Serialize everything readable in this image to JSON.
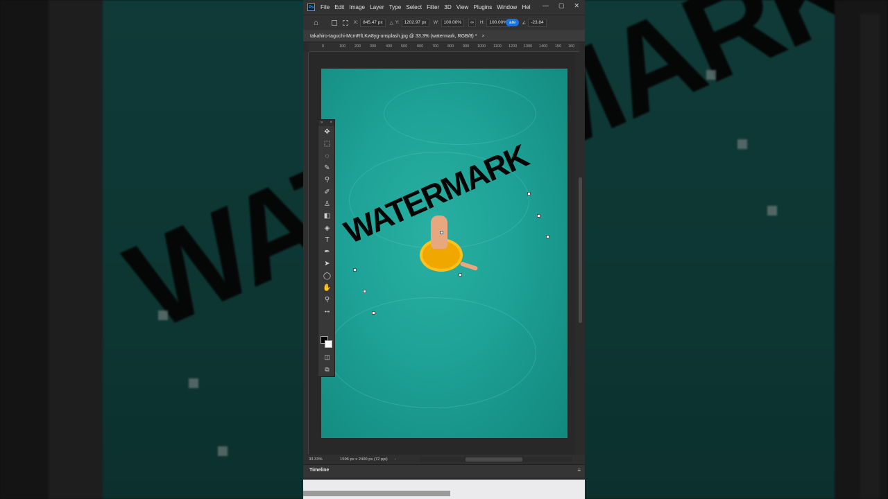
{
  "app": {
    "logo": "Ps",
    "menu": [
      "File",
      "Edit",
      "Image",
      "Layer",
      "Type",
      "Select",
      "Filter",
      "3D",
      "View",
      "Plugins",
      "Window",
      "Hel"
    ],
    "window_buttons": [
      "—",
      "▢",
      "✕"
    ]
  },
  "options_bar": {
    "x_label": "X:",
    "x_value": "845.47 px",
    "y_label": "Y:",
    "y_value": "1202.97 px",
    "w_label": "W:",
    "w_value": "100.00%",
    "h_label": "H:",
    "h_value": "100.00%",
    "highlight_text": "are",
    "angle_value": "-23.84"
  },
  "document": {
    "tab_title": "takahiro-taguchi-McmRfLKw8yg-unsplash.jpg @ 33.3% (watermark, RGB/8) *",
    "tab_close": "×",
    "watermark_text": "WATERMARK"
  },
  "ruler": {
    "ticks": [
      "0",
      "100",
      "200",
      "300",
      "400",
      "500",
      "600",
      "700",
      "800",
      "900",
      "1000",
      "1100",
      "1200",
      "1300",
      "1400",
      "150",
      "160"
    ]
  },
  "toolbox": {
    "head_left": "»",
    "head_right": "×",
    "tools": [
      {
        "name": "move-tool-icon",
        "glyph": "✥"
      },
      {
        "name": "marquee-tool-icon",
        "glyph": "⬚"
      },
      {
        "name": "lasso-tool-icon",
        "glyph": "◌"
      },
      {
        "name": "quick-select-tool-icon",
        "glyph": "✎"
      },
      {
        "name": "eyedropper-tool-icon",
        "glyph": "⚲"
      },
      {
        "name": "brush-tool-icon",
        "glyph": "✐"
      },
      {
        "name": "stamp-tool-icon",
        "glyph": "♙"
      },
      {
        "name": "eraser-tool-icon",
        "glyph": "◧"
      },
      {
        "name": "gradient-tool-icon",
        "glyph": "◈"
      },
      {
        "name": "type-tool-icon",
        "glyph": "T"
      },
      {
        "name": "pen-tool-icon",
        "glyph": "✒"
      },
      {
        "name": "path-select-tool-icon",
        "glyph": "➤"
      },
      {
        "name": "ellipse-tool-icon",
        "glyph": "◯"
      },
      {
        "name": "hand-tool-icon",
        "glyph": "✋"
      },
      {
        "name": "zoom-tool-icon",
        "glyph": "⚲"
      },
      {
        "name": "more-tools-icon",
        "glyph": "•••"
      }
    ],
    "quick_mask_glyph": "◫",
    "screen_mode_glyph": "⧉"
  },
  "status": {
    "zoom": "33.33%",
    "dimensions": "1596 px x 2400 px (72 ppi)",
    "arrow": "›"
  },
  "timeline": {
    "label": "Timeline",
    "menu_glyph": "≡"
  },
  "colors": {
    "foreground": "#000000",
    "background": "#ffffff",
    "accent": "#1473e6",
    "water": "#1ea196"
  }
}
